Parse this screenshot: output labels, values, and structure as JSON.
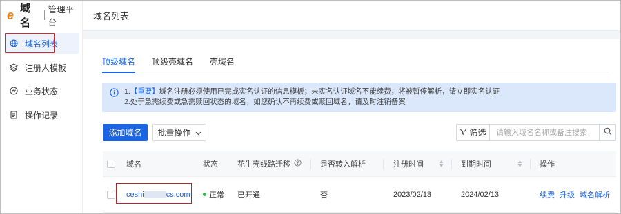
{
  "brand": {
    "logo_letter": "e",
    "name": "域名",
    "subtitle": "管理平台",
    "accent_color": "#e8841c"
  },
  "colors": {
    "primary": "#1b64e3",
    "highlight_box": "#d9262b",
    "status_ok": "#2fb34a"
  },
  "sidebar": {
    "items": [
      {
        "label": "域名列表",
        "icon": "globe-icon",
        "active": true
      },
      {
        "label": "注册人模板",
        "icon": "layers-icon",
        "active": false
      },
      {
        "label": "业务状态",
        "icon": "status-circle-icon",
        "active": false
      },
      {
        "label": "操作记录",
        "icon": "document-icon",
        "active": false
      }
    ]
  },
  "header": {
    "title": "域名列表"
  },
  "tabs": [
    {
      "label": "顶级域名",
      "active": true
    },
    {
      "label": "顶级壳域名",
      "active": false
    },
    {
      "label": "壳域名",
      "active": false
    }
  ],
  "notice": {
    "icon": "info-icon",
    "line1_prefix": "1.",
    "line1_highlight": "【重要】",
    "line1_rest": "域名注册必须使用已完成实名认证的信息模板；未实名认证域名不能续费，将被暂停解析，请立即实名认证",
    "line2": "2.处于急需续费或急需赎回状态的域名，如您确认不再续费或赎回域名，请及时注销备案"
  },
  "toolbar": {
    "add_label": "添加域名",
    "batch_label": "批量操作",
    "batch_icon": "chevron-down-icon",
    "filter_label": "筛选",
    "filter_icon": "funnel-icon",
    "search_placeholder": "请输入域名名称或备注搜索",
    "search_icon": "search-icon"
  },
  "table": {
    "columns": [
      "域名",
      "状态",
      "花生壳线路迁移",
      "是否转入解析",
      "注册时间",
      "到期时间",
      "操作"
    ],
    "rows": [
      {
        "domain_prefix": "ceshi",
        "domain_suffix": "cs.com",
        "status": "正常",
        "migration": "已开通",
        "transfer_dns": "否",
        "registered": "2023/02/13",
        "expires": "2024/02/13",
        "actions": [
          "续费",
          "升级",
          "域名解析"
        ]
      }
    ]
  }
}
